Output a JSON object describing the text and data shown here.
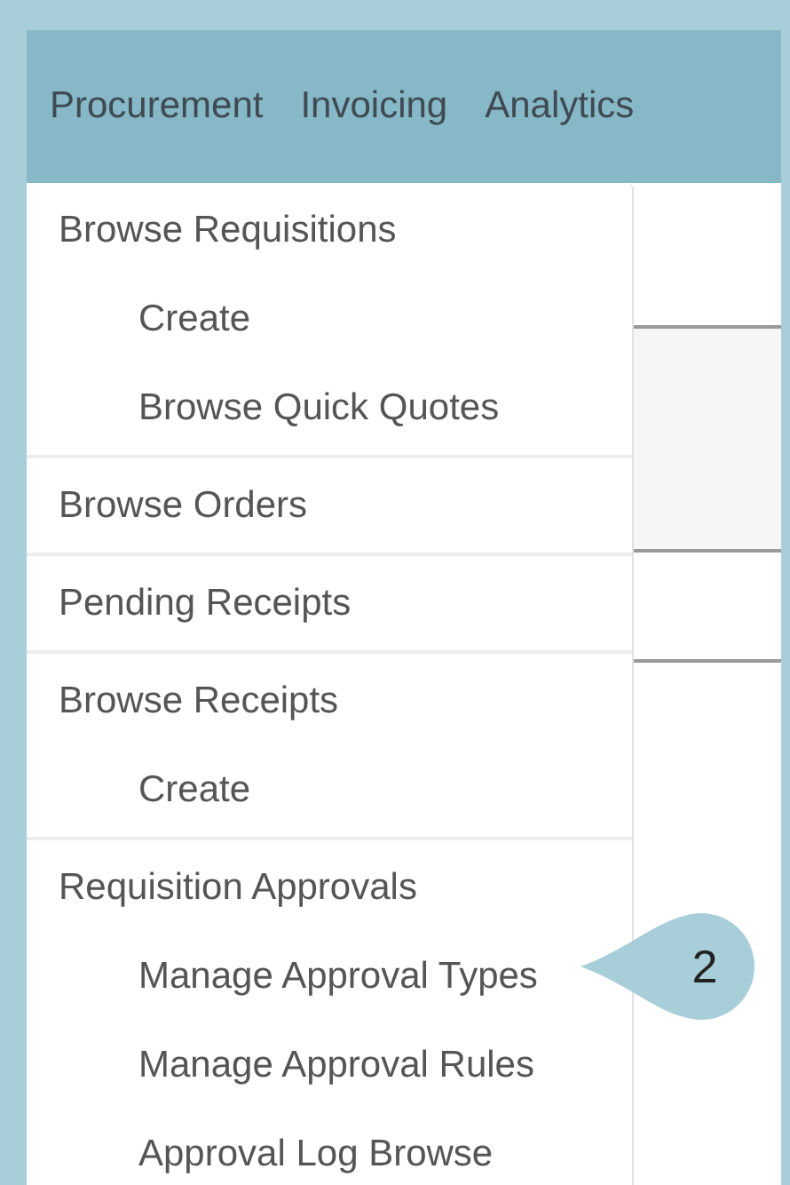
{
  "nav_tabs": [
    {
      "label": "Procurement"
    },
    {
      "label": "Invoicing"
    },
    {
      "label": "Analytics"
    }
  ],
  "menu_groups": [
    {
      "items": [
        {
          "label": "Browse Requisitions",
          "kind": "header"
        },
        {
          "label": "Create",
          "kind": "sub"
        },
        {
          "label": "Browse Quick Quotes",
          "kind": "sub"
        }
      ]
    },
    {
      "items": [
        {
          "label": "Browse Orders",
          "kind": "header"
        }
      ]
    },
    {
      "items": [
        {
          "label": "Pending Receipts",
          "kind": "header"
        }
      ]
    },
    {
      "items": [
        {
          "label": "Browse Receipts",
          "kind": "header"
        },
        {
          "label": "Create",
          "kind": "sub"
        }
      ]
    },
    {
      "items": [
        {
          "label": "Requisition Approvals",
          "kind": "header"
        },
        {
          "label": "Manage Approval Types",
          "kind": "sub"
        },
        {
          "label": "Manage Approval Rules",
          "kind": "sub"
        },
        {
          "label": "Approval Log Browse",
          "kind": "sub"
        }
      ]
    }
  ],
  "callout": {
    "label": "2"
  }
}
